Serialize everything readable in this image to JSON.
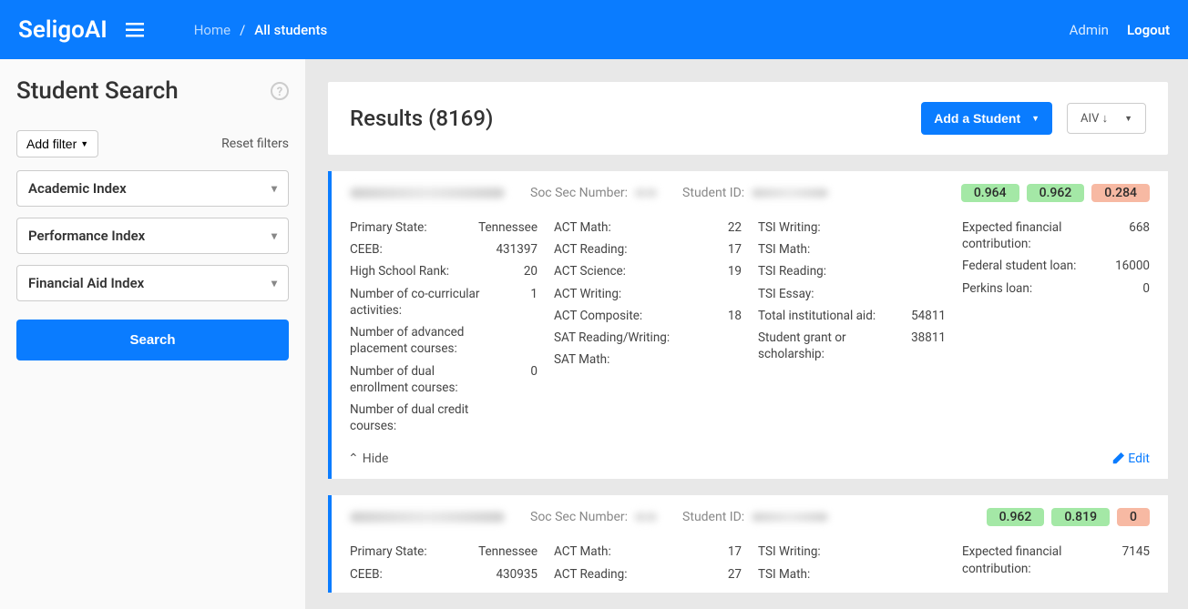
{
  "brand": "SeligoAI",
  "breadcrumb": {
    "home": "Home",
    "current": "All students"
  },
  "topnav": {
    "admin": "Admin",
    "logout": "Logout"
  },
  "sidebar": {
    "title": "Student Search",
    "add_filter": "Add filter",
    "reset_filters": "Reset filters",
    "dropdowns": [
      "Academic Index",
      "Performance Index",
      "Financial Aid Index"
    ],
    "search_btn": "Search"
  },
  "results": {
    "title": "Results (8169)",
    "add_student": "Add a Student",
    "sort_label": "AIV ↓"
  },
  "fields": {
    "ssn": "Soc Sec Number:",
    "student_id": "Student ID:",
    "hide": "Hide",
    "edit": "Edit"
  },
  "students": [
    {
      "badges": [
        "0.964",
        "0.962",
        "0.284"
      ],
      "col1": [
        {
          "l": "Primary State:",
          "v": "Tennessee"
        },
        {
          "l": "CEEB:",
          "v": "431397"
        },
        {
          "l": "High School Rank:",
          "v": "20"
        },
        {
          "l": "Number of co-curricular activities:",
          "v": "1"
        },
        {
          "l": "Number of advanced placement courses:",
          "v": ""
        },
        {
          "l": "Number of dual enrollment courses:",
          "v": "0"
        },
        {
          "l": "Number of dual credit courses:",
          "v": ""
        }
      ],
      "col2": [
        {
          "l": "ACT Math:",
          "v": "22"
        },
        {
          "l": "ACT Reading:",
          "v": "17"
        },
        {
          "l": "ACT Science:",
          "v": "19"
        },
        {
          "l": "ACT Writing:",
          "v": ""
        },
        {
          "l": "ACT Composite:",
          "v": "18"
        },
        {
          "l": "SAT Reading/Writing:",
          "v": ""
        },
        {
          "l": "SAT Math:",
          "v": ""
        }
      ],
      "col3": [
        {
          "l": "TSI Writing:",
          "v": ""
        },
        {
          "l": "TSI Math:",
          "v": ""
        },
        {
          "l": "TSI Reading:",
          "v": ""
        },
        {
          "l": "TSI Essay:",
          "v": ""
        },
        {
          "l": "Total institutional aid:",
          "v": "54811"
        },
        {
          "l": "Student grant or scholarship:",
          "v": "38811"
        }
      ],
      "col4": [
        {
          "l": "Expected financial contribution:",
          "v": "668"
        },
        {
          "l": "Federal student loan:",
          "v": "16000"
        },
        {
          "l": "Perkins loan:",
          "v": "0"
        }
      ]
    },
    {
      "badges": [
        "0.962",
        "0.819",
        "0"
      ],
      "col1": [
        {
          "l": "Primary State:",
          "v": "Tennessee"
        },
        {
          "l": "CEEB:",
          "v": "430935"
        }
      ],
      "col2": [
        {
          "l": "ACT Math:",
          "v": "17"
        },
        {
          "l": "ACT Reading:",
          "v": "27"
        }
      ],
      "col3": [
        {
          "l": "TSI Writing:",
          "v": ""
        },
        {
          "l": "TSI Math:",
          "v": ""
        }
      ],
      "col4": [
        {
          "l": "Expected financial contribution:",
          "v": "7145"
        }
      ]
    }
  ]
}
